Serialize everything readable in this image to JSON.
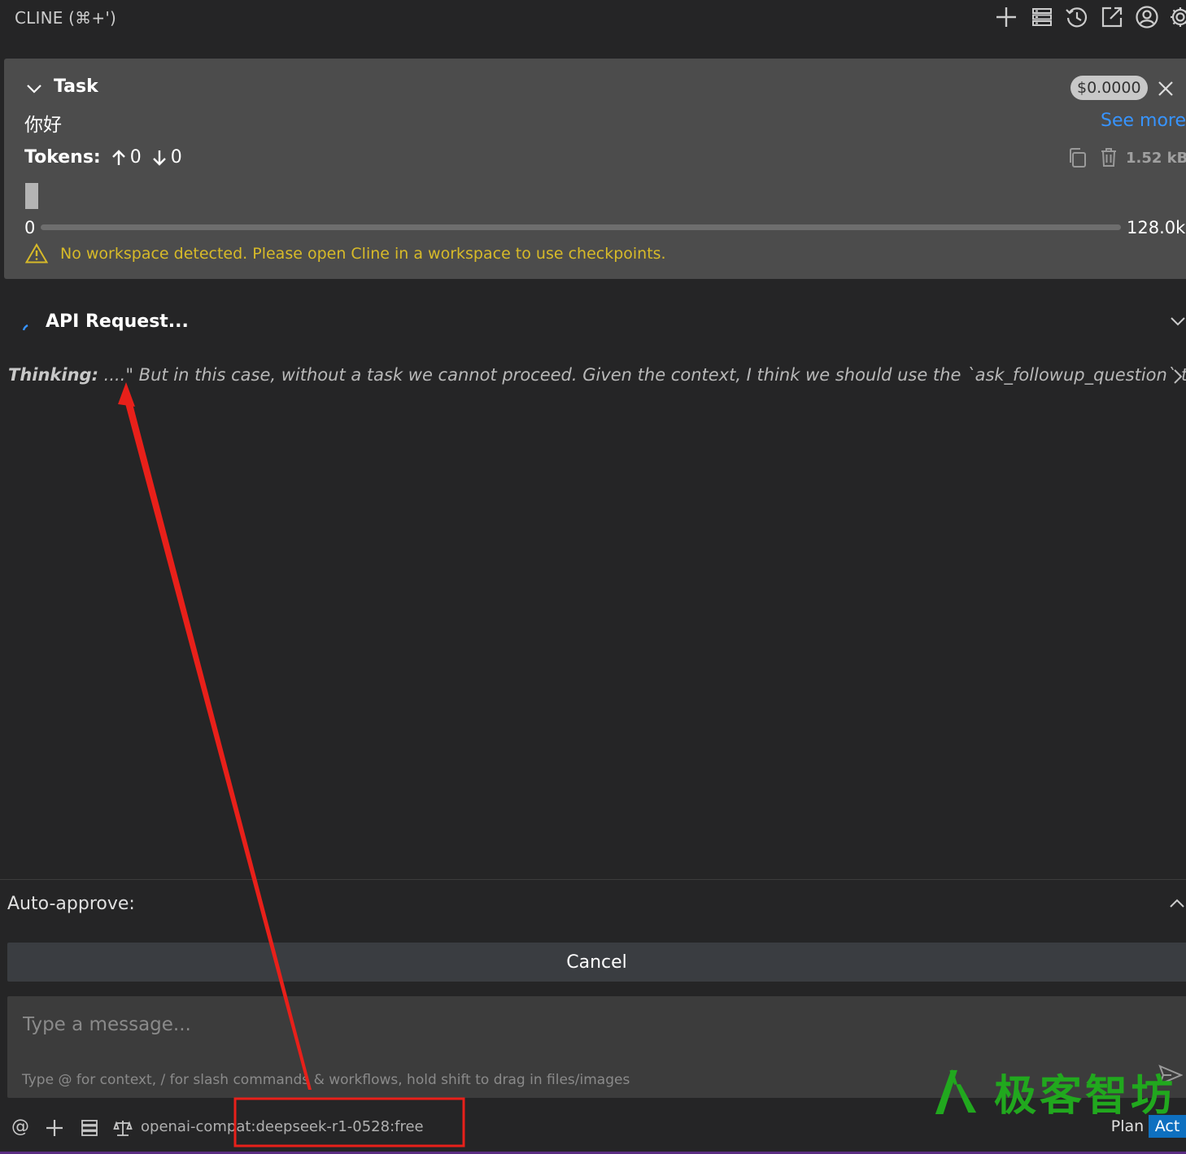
{
  "header": {
    "title": "CLINE (⌘+')",
    "icons": [
      "plus-icon",
      "server-icon",
      "history-icon",
      "popout-icon",
      "account-icon",
      "settings-icon"
    ]
  },
  "task": {
    "label": "Task",
    "cost": "$0.0000",
    "text": "你好",
    "see_more": "See more",
    "tokens_label": "Tokens:",
    "tokens_in": "0",
    "tokens_out": "0",
    "size": "1.52 kB",
    "context_used": "0",
    "context_max": "128.0k",
    "context_fraction": 0.0,
    "warning": "No workspace detected. Please open Cline in a workspace to use checkpoints."
  },
  "api_request": {
    "title": "API Request...",
    "thinking_label": "Thinking:",
    "thinking_text": " ....\" But in this case, without a task we cannot proceed. Given the context, I think we should use the `ask_followup_question` tool to"
  },
  "auto_approve": {
    "label": "Auto-approve:"
  },
  "cancel_label": "Cancel",
  "composer": {
    "placeholder": "Type a message...",
    "hint": "Type @ for context, / for slash commands & workflows, hold shift to drag in files/images"
  },
  "footer": {
    "at_symbol": "@",
    "model": "openai-compat:deepseek-r1-0528:free",
    "plan_label": "Plan",
    "act_label": "Act",
    "active_mode": "Act"
  },
  "watermark": {
    "text": "极客智坊"
  },
  "colors": {
    "background": "#252526",
    "panel": "#4c4c4c",
    "link": "#3794ff",
    "warning": "#d7ba29",
    "annotation_red": "#e8201a",
    "act_active": "#0e70c0",
    "watermark_green": "#21a81e"
  }
}
